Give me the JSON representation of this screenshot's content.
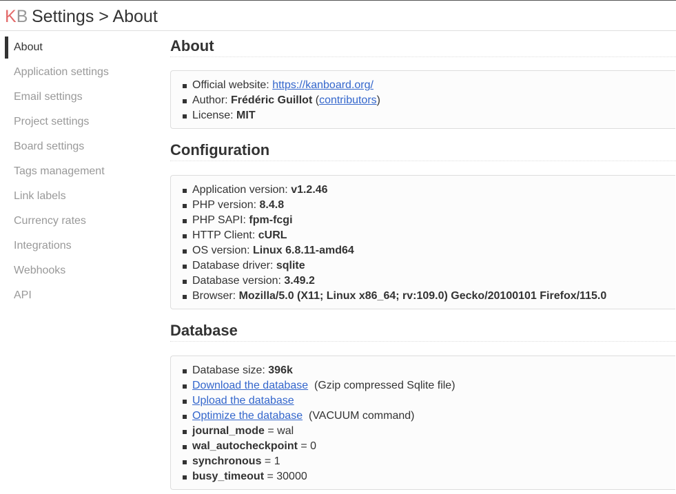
{
  "header": {
    "logo_k": "K",
    "logo_b": "B",
    "title": "Settings > About"
  },
  "sidebar": {
    "items": [
      {
        "label": "About",
        "active": true
      },
      {
        "label": "Application settings"
      },
      {
        "label": "Email settings"
      },
      {
        "label": "Project settings"
      },
      {
        "label": "Board settings"
      },
      {
        "label": "Tags management"
      },
      {
        "label": "Link labels"
      },
      {
        "label": "Currency rates"
      },
      {
        "label": "Integrations"
      },
      {
        "label": "Webhooks"
      },
      {
        "label": "API"
      }
    ]
  },
  "about": {
    "heading": "About",
    "website_label": "Official website: ",
    "website_link": "https://kanboard.org/",
    "author_label": "Author: ",
    "author_name": "Frédéric Guillot",
    "author_open": " (",
    "contributors_link": "contributors",
    "author_close": ")",
    "license_label": "License: ",
    "license_value": "MIT"
  },
  "configuration": {
    "heading": "Configuration",
    "rows": [
      {
        "label": "Application version: ",
        "value": "v1.2.46"
      },
      {
        "label": "PHP version: ",
        "value": "8.4.8"
      },
      {
        "label": "PHP SAPI: ",
        "value": "fpm-fcgi"
      },
      {
        "label": "HTTP Client: ",
        "value": "cURL"
      },
      {
        "label": "OS version: ",
        "value": "Linux 6.8.11-amd64"
      },
      {
        "label": "Database driver: ",
        "value": "sqlite"
      },
      {
        "label": "Database version: ",
        "value": "3.49.2"
      },
      {
        "label": "Browser: ",
        "value": "Mozilla/5.0 (X11; Linux x86_64; rv:109.0) Gecko/20100101 Firefox/115.0"
      }
    ]
  },
  "database": {
    "heading": "Database",
    "size_label": "Database size: ",
    "size_value": "396k",
    "download_link": "Download the database",
    "download_note": "(Gzip compressed Sqlite file)",
    "upload_link": "Upload the database",
    "optimize_link": "Optimize the database",
    "optimize_note": "(VACUUM command)",
    "pragmas": [
      {
        "key": "journal_mode",
        "value": " = wal"
      },
      {
        "key": "wal_autocheckpoint",
        "value": " = 0"
      },
      {
        "key": "synchronous",
        "value": " = 1"
      },
      {
        "key": "busy_timeout",
        "value": " = 30000"
      }
    ]
  },
  "colors": {
    "accent": "#e36a6a",
    "link": "#3366cc",
    "muted": "#999999",
    "text": "#333333"
  }
}
